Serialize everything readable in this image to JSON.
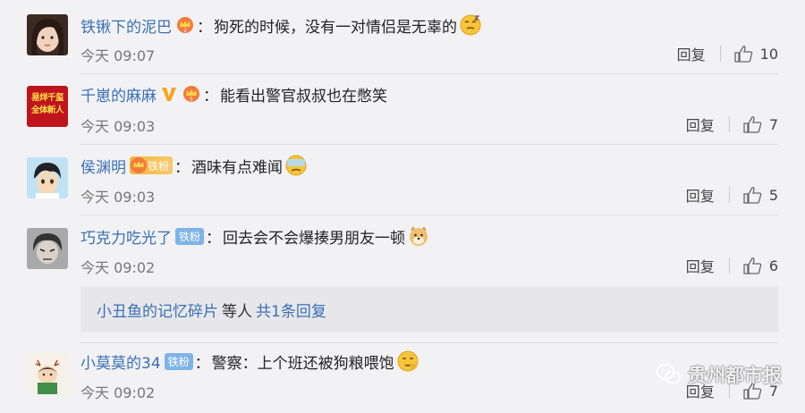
{
  "comments": [
    {
      "name": "铁锹下的泥巴",
      "text": "狗死的时候，没有一对情侣是无辜的",
      "time": "今天 09:07",
      "reply": "回复",
      "likes": "10"
    },
    {
      "name": "千崽的麻麻",
      "text": "能看出警官叔叔也在憋笑",
      "time": "今天 09:03",
      "reply": "回复",
      "likes": "7",
      "avatar_text": "易烊千玺 全体新人"
    },
    {
      "name": "侯渊明",
      "badge": "铁粉",
      "text": "酒味有点难闻",
      "time": "今天 09:03",
      "reply": "回复",
      "likes": "5"
    },
    {
      "name": "巧克力吃光了",
      "badge": "铁粉",
      "text": "回去会不会爆揍男朋友一顿",
      "time": "今天 09:02",
      "reply": "回复",
      "likes": "6"
    },
    {
      "name": "小莫莫的34",
      "badge": "铁粉",
      "text": "警察：上个班还被狗粮喂饱",
      "time": "今天 09:02",
      "reply": "回复",
      "likes": "7"
    }
  ],
  "colon": "：",
  "subreplies": {
    "name": "小丑鱼的记忆碎片",
    "middle": "等人",
    "count": "共1条回复"
  },
  "watermark": "贵州都市报",
  "colors": {
    "link": "#3a6fb4",
    "background": "#f2f2f5",
    "badge": "#7fb3e6"
  },
  "icons": [
    "crown-icon",
    "v-verified-icon",
    "thumbs-up-icon",
    "wechat-icon",
    "emoji-icon"
  ]
}
